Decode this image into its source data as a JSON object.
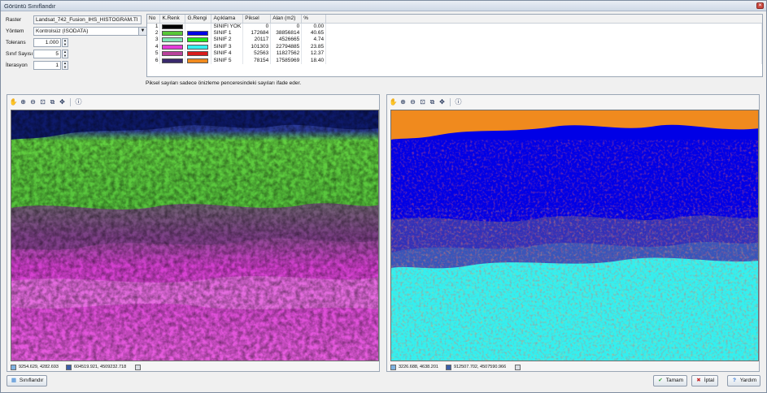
{
  "window": {
    "title": "Görüntü Sınıflandır",
    "close_icon": "close-icon"
  },
  "params": {
    "raster_label": "Raster",
    "raster_value": "Landsat_742_Fusion_IHS_HISTOGRAM.TI",
    "method_label": "Yöntem",
    "method_value": "Kontrolsüz (ISODATA)",
    "tolerance_label": "Tolerans",
    "tolerance_value": "1.000",
    "class_count_label": "Sınıf Sayısı",
    "class_count_value": "5",
    "iteration_label": "İterasyon",
    "iteration_value": "1"
  },
  "table": {
    "headers": [
      "No",
      "K.Renk",
      "G.Rengi",
      "Açıklama",
      "Piksel",
      "Alan (m2)",
      "%"
    ],
    "rows": [
      {
        "no": "1",
        "krenk": "#000000",
        "grengi": "",
        "aciklama": "SINIFI YOK",
        "piksel": "0",
        "alan": "0",
        "yuzde": "0.00"
      },
      {
        "no": "2",
        "krenk": "#58c838",
        "grengi": "#0000e6",
        "aciklama": "SINIF 1",
        "piksel": "172684",
        "alan": "38856814",
        "yuzde": "40.65"
      },
      {
        "no": "3",
        "krenk": "#7ee6b4",
        "grengi": "#22e81c",
        "aciklama": "SINIF 2",
        "piksel": "20117",
        "alan": "4526665",
        "yuzde": "4.74"
      },
      {
        "no": "4",
        "krenk": "#e43cd8",
        "grengi": "#32f0f0",
        "aciklama": "SINIF 3",
        "piksel": "101303",
        "alan": "22794885",
        "yuzde": "23.85"
      },
      {
        "no": "5",
        "krenk": "#b9429c",
        "grengi": "#d81c1c",
        "aciklama": "SINIF 4",
        "piksel": "52563",
        "alan": "11827562",
        "yuzde": "12.37"
      },
      {
        "no": "6",
        "krenk": "#3a2a6c",
        "grengi": "#f08a1e",
        "aciklama": "SINIF 5",
        "piksel": "78154",
        "alan": "17585969",
        "yuzde": "18.40"
      }
    ]
  },
  "note": "Piksel sayıları sadece önizleme penceresindeki sayıları ifade eder.",
  "toolbar_icons": [
    "pan-icon",
    "zoom-in-icon",
    "zoom-out-icon",
    "zoom-box-icon",
    "zoom-layer-icon",
    "full-extent-icon",
    "info-icon"
  ],
  "left_status": {
    "coords": "9254.629, 4282.693",
    "map_coords": "604519.921, 4509232.718"
  },
  "right_status": {
    "coords": "3226.688, 4638.201",
    "map_coords": "912507.702, 4507590.966"
  },
  "buttons": {
    "classify": "Sınıflandır",
    "ok": "Tamam",
    "cancel": "İptal",
    "help": "Yardım"
  },
  "colors": {
    "class1": "#0000e6",
    "class2": "#22e81c",
    "class3": "#32f0f0",
    "class4": "#d81c1c",
    "class5": "#f08a1e",
    "magenta": "#e43cd8",
    "green": "#58c838"
  }
}
